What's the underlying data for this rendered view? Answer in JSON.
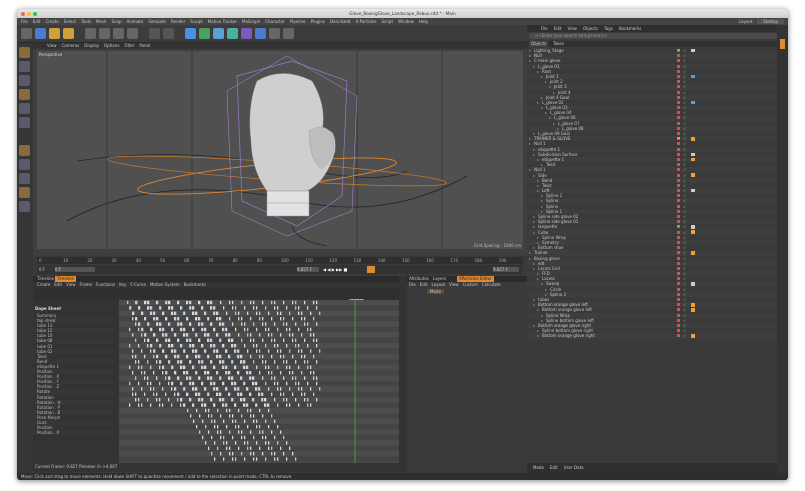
{
  "window": {
    "title": "Glove_BoxingGlove_Landscape_Rebus.c4d * - Main",
    "layout_label": "Layout:",
    "layout_value": "Startup"
  },
  "menubar": [
    "File",
    "Edit",
    "Create",
    "Select",
    "Tools",
    "Mesh",
    "Snap",
    "Animate",
    "Simulate",
    "Render",
    "Sculpt",
    "Motion Tracker",
    "MoGraph",
    "Character",
    "Pipeline",
    "Plugins",
    "Deni Kaldt",
    "X-Particles",
    "Script",
    "Window",
    "Help"
  ],
  "toolbar_icons": [
    "undo-icon",
    "move-icon",
    "scale-icon",
    "rotate-icon",
    "x-axis-icon",
    "y-axis-icon",
    "z-axis-icon",
    "world-icon",
    "render-icon",
    "render-view-icon",
    "cube-icon",
    "pen-icon",
    "subdivision-icon",
    "cloner-icon",
    "deformer-icon",
    "scene-icon",
    "camera-icon",
    "light-icon"
  ],
  "viewport": {
    "menu": [
      "View",
      "Cameras",
      "Display",
      "Options",
      "Filter",
      "Panel"
    ],
    "label": "Perspective",
    "grid_spacing": "Grid Spacing : 1000 cm"
  },
  "timeline": {
    "ticks": [
      "0",
      "10",
      "20",
      "30",
      "40",
      "50",
      "60",
      "70",
      "80",
      "90",
      "100",
      "110",
      "120",
      "130",
      "140",
      "150",
      "160",
      "170",
      "180",
      "190"
    ],
    "frame_left": "0 F",
    "frame_start": "0 F",
    "frame_current": "9.827 F",
    "frame_end": "9.827 F"
  },
  "dopesheet": {
    "tabs": [
      "Timeline",
      "Timeline"
    ],
    "menu": [
      "Create",
      "Edit",
      "View",
      "Frame",
      "Functions",
      "Key",
      "F-Curve",
      "Motion System",
      "Bookmarks"
    ],
    "title": "Dope Sheet",
    "current_marker": "9.827",
    "tracks": [
      "Summary",
      "top shear",
      "tube 13",
      "tube 12",
      "tube 10",
      "tube 08",
      "tube 01",
      "tube 02",
      "Twist",
      "Bend",
      "etiquette 1",
      "Position",
      "Position . X",
      "Position . Y",
      "Position . Z",
      "Rotate",
      "Rotation",
      "Rotation . H",
      "Rotation . P",
      "Rotation . B",
      "Pose Morph",
      "Gust",
      "Position",
      "Position . X"
    ],
    "footer": "Current Frame: 9.827  Preview: 0-->4.667"
  },
  "attributes": {
    "tabs": [
      "Attributes",
      "Layers",
      "XParticles Editor"
    ],
    "menu": [
      "Mode",
      "Edit",
      "User Data"
    ],
    "panel_menu": [
      "File",
      "Edit",
      "Layout",
      "View",
      "Custom",
      "Calculate"
    ],
    "mode_label": "Mode"
  },
  "objects": {
    "menu": [
      "File",
      "Edit",
      "View",
      "Objects",
      "Tags",
      "Bookmarks"
    ],
    "search_placeholder": "<<Enter your search string here>>",
    "tabs": [
      "Objects",
      "Takes"
    ],
    "items": [
      {
        "name": "Lighting_Stage",
        "indent": 0,
        "dot": "#6cc24a",
        "tag": "#ccc"
      },
      {
        "name": "Null",
        "indent": 0,
        "dot": "#e84a4a",
        "tag": ""
      },
      {
        "name": "C-main glove",
        "indent": 0,
        "dot": "#e84a4a",
        "tag": ""
      },
      {
        "name": "L_glove 01",
        "indent": 1,
        "dot": "#e84a4a",
        "tag": ""
      },
      {
        "name": "Root",
        "indent": 2,
        "dot": "#e84a4a",
        "tag": ""
      },
      {
        "name": "Joint 1",
        "indent": 3,
        "dot": "#e84a4a",
        "tag": "#4aa3e8"
      },
      {
        "name": "Joint 2",
        "indent": 4,
        "dot": "#e84a4a",
        "tag": ""
      },
      {
        "name": "Joint 3",
        "indent": 5,
        "dot": "#e84a4a",
        "tag": ""
      },
      {
        "name": "Joint 4",
        "indent": 6,
        "dot": "#e84a4a",
        "tag": ""
      },
      {
        "name": "Joint 4 Goal",
        "indent": 3,
        "dot": "#e84a4a",
        "tag": ""
      },
      {
        "name": "L_glove 02",
        "indent": 2,
        "dot": "#e84a4a",
        "tag": "#4aa3e8"
      },
      {
        "name": "L_glove 03",
        "indent": 3,
        "dot": "#e84a4a",
        "tag": ""
      },
      {
        "name": "L_glove 04",
        "indent": 4,
        "dot": "#e84a4a",
        "tag": ""
      },
      {
        "name": "L_glove 06",
        "indent": 5,
        "dot": "#e84a4a",
        "tag": ""
      },
      {
        "name": "L_glove 07",
        "indent": 6,
        "dot": "#e84a4a",
        "tag": ""
      },
      {
        "name": "L_glove 08",
        "indent": 7,
        "dot": "#e84a4a",
        "tag": ""
      },
      {
        "name": "L_glove 09 Goal",
        "indent": 1,
        "dot": "#e84a4a",
        "tag": ""
      },
      {
        "name": "TRAINER & GLOVE",
        "indent": 0,
        "dot": "#f0a030",
        "tag": "#f0a030"
      },
      {
        "name": "Null 1",
        "indent": 0,
        "dot": "#e84a4a",
        "tag": ""
      },
      {
        "name": "etiquette 1",
        "indent": 1,
        "dot": "#e84a4a",
        "tag": ""
      },
      {
        "name": "Subdivision Surface",
        "indent": 1,
        "dot": "#e84a4a",
        "tag": "#ccc"
      },
      {
        "name": "etiquette 1",
        "indent": 2,
        "dot": "#e84a4a",
        "tag": "#f0a030"
      },
      {
        "name": "Twist",
        "indent": 3,
        "dot": "#e84a4a",
        "tag": ""
      },
      {
        "name": "Null 1",
        "indent": 0,
        "dot": "#e84a4a",
        "tag": ""
      },
      {
        "name": "Side",
        "indent": 1,
        "dot": "#e84a4a",
        "tag": "#f0a030"
      },
      {
        "name": "Bend",
        "indent": 2,
        "dot": "#e84a4a",
        "tag": ""
      },
      {
        "name": "Twist",
        "indent": 2,
        "dot": "#e84a4a",
        "tag": ""
      },
      {
        "name": "Loft",
        "indent": 2,
        "dot": "#e84a4a",
        "tag": "#ccc"
      },
      {
        "name": "Spline 2",
        "indent": 3,
        "dot": "#e84a4a",
        "tag": ""
      },
      {
        "name": "Spline",
        "indent": 3,
        "dot": "#e84a4a",
        "tag": ""
      },
      {
        "name": "Spline",
        "indent": 3,
        "dot": "#e84a4a",
        "tag": ""
      },
      {
        "name": "Spline 1",
        "indent": 3,
        "dot": "#e84a4a",
        "tag": ""
      },
      {
        "name": "Spline side glove 02",
        "indent": 1,
        "dot": "#e84a4a",
        "tag": ""
      },
      {
        "name": "Spline side glove 01",
        "indent": 1,
        "dot": "#e84a4a",
        "tag": ""
      },
      {
        "name": "languette",
        "indent": 1,
        "dot": "#6cc24a",
        "tag": "#ccc"
      },
      {
        "name": "Cube",
        "indent": 1,
        "dot": "#e84a4a",
        "tag": "#f0a030"
      },
      {
        "name": "Spline Wrap",
        "indent": 2,
        "dot": "#e84a4a",
        "tag": ""
      },
      {
        "name": "Symetry",
        "indent": 2,
        "dot": "#e84a4a",
        "tag": ""
      },
      {
        "name": "Bottom shoe",
        "indent": 1,
        "dot": "#e84a4a",
        "tag": ""
      },
      {
        "name": "Trainer",
        "indent": 0,
        "dot": "#e84a4a",
        "tag": "#f0a030"
      },
      {
        "name": "Boxing glove",
        "indent": 0,
        "dot": "#e84a4a",
        "tag": ""
      },
      {
        "name": "edt",
        "indent": 1,
        "dot": "#e84a4a",
        "tag": ""
      },
      {
        "name": "Lacets End",
        "indent": 1,
        "dot": "#e84a4a",
        "tag": ""
      },
      {
        "name": "FFD",
        "indent": 2,
        "dot": "#e84a4a",
        "tag": ""
      },
      {
        "name": "Lacets",
        "indent": 2,
        "dot": "#e84a4a",
        "tag": ""
      },
      {
        "name": "Sweep",
        "indent": 3,
        "dot": "#e84a4a",
        "tag": "#ccc"
      },
      {
        "name": "Circle",
        "indent": 4,
        "dot": "#e84a4a",
        "tag": ""
      },
      {
        "name": "Spline 2",
        "indent": 4,
        "dot": "#e84a4a",
        "tag": ""
      },
      {
        "name": "tubes",
        "indent": 1,
        "dot": "#e84a4a",
        "tag": ""
      },
      {
        "name": "Bottom orange glove left",
        "indent": 1,
        "dot": "#e84a4a",
        "tag": "#f0a030"
      },
      {
        "name": "Bottom orange glove left",
        "indent": 2,
        "dot": "#e84a4a",
        "tag": "#f0a030"
      },
      {
        "name": "Spline Wrap",
        "indent": 3,
        "dot": "#e84a4a",
        "tag": ""
      },
      {
        "name": "Spline bottom glove left",
        "indent": 3,
        "dot": "#e84a4a",
        "tag": ""
      },
      {
        "name": "Bottom orange glove right",
        "indent": 1,
        "dot": "#e84a4a",
        "tag": ""
      },
      {
        "name": "Spline bottom glove right",
        "indent": 2,
        "dot": "#e84a4a",
        "tag": ""
      },
      {
        "name": "Bottom orange glove right",
        "indent": 2,
        "dot": "#e84a4a",
        "tag": "#f0a030"
      }
    ]
  },
  "statusbar": "Move: Click and drag to move elements. Hold down SHIFT to quantize movement / add to the selection in point mode, CTRL to remove."
}
